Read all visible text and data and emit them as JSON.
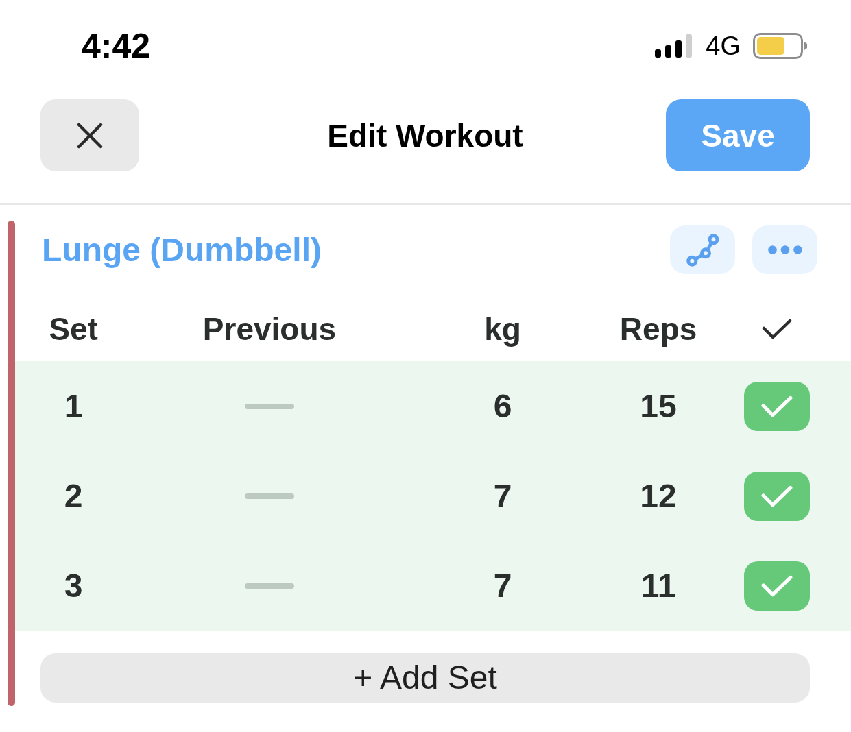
{
  "status_bar": {
    "time": "4:42",
    "network": "4G"
  },
  "header": {
    "title": "Edit Workout",
    "save": "Save"
  },
  "exercise": {
    "name": "Lunge (Dumbbell)",
    "columns": [
      "Set",
      "Previous",
      "kg",
      "Reps"
    ],
    "sets": [
      {
        "set": "1",
        "weight": "6",
        "reps": "15",
        "completed": true
      },
      {
        "set": "2",
        "weight": "7",
        "reps": "12",
        "completed": true
      },
      {
        "set": "3",
        "weight": "7",
        "reps": "11",
        "completed": true
      }
    ],
    "add_set": "+ Add Set"
  }
}
